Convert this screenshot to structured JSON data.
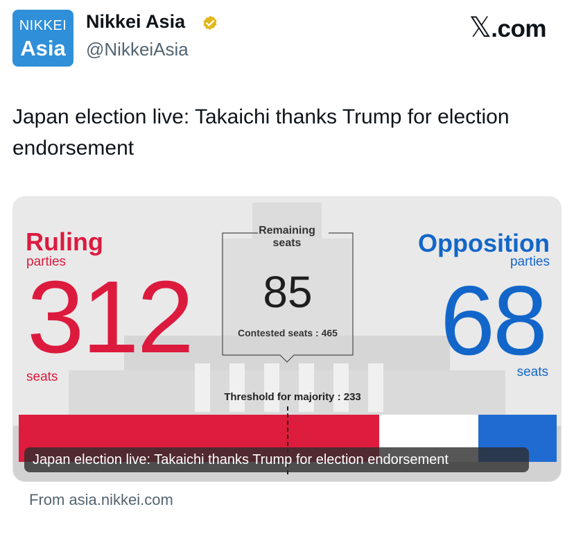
{
  "profile": {
    "avatar_line1": "NIKKEI",
    "avatar_line2": "Asia",
    "name": "Nikkei Asia",
    "handle": "@NikkeiAsia",
    "verified_icon": "verified-badge-icon"
  },
  "brand": {
    "x_glyph": "𝕏",
    "domain": ".com"
  },
  "tweet": {
    "text": "Japan election live: Takaichi thanks Trump for election endorsement"
  },
  "card": {
    "ruling": {
      "title": "Ruling",
      "sub": "parties",
      "count": "312",
      "unit": "seats",
      "color": "#dc1a3e"
    },
    "opposition": {
      "title": "Opposition",
      "sub": "parties",
      "count": "68",
      "unit": "seats",
      "color": "#1366c9"
    },
    "remaining": {
      "label": "Remaining seats",
      "count": "85"
    },
    "contested": "Contested seats : 465",
    "threshold": "Threshold for majority : 233",
    "bar": {
      "ruling": 312,
      "remaining": 85,
      "opposition": 68,
      "total": 465,
      "majority": 233
    },
    "caption": "Japan election live: Takaichi thanks Trump for election endorsement"
  },
  "source": "From asia.nikkei.com"
}
